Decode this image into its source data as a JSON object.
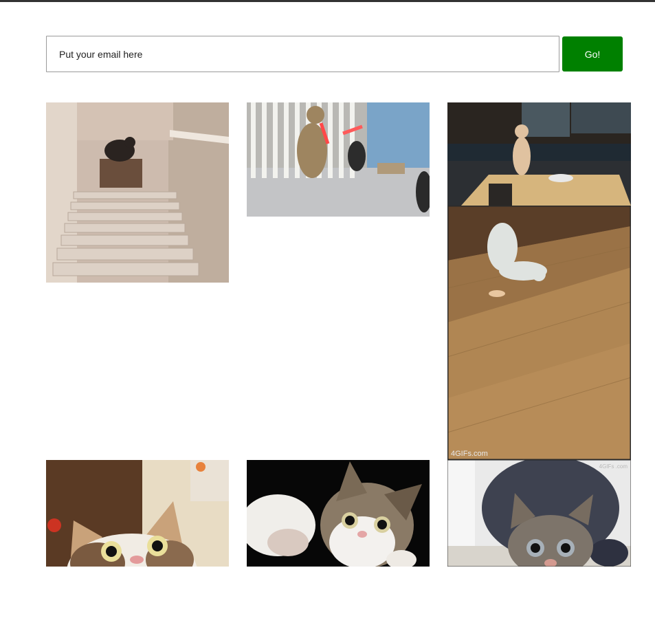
{
  "signup": {
    "email_placeholder": "Put your email here",
    "email_value": "",
    "submit_label": "Go!",
    "submit_color": "#008000"
  },
  "gallery": {
    "items": [
      {
        "icon": "cat-stairs-gif"
      },
      {
        "icon": "cats-lightsaber-gif"
      },
      {
        "icon": "cat-on-table-gif"
      },
      {
        "icon": "cat-chasing-laser-gif",
        "watermark": "4GIFs.com"
      },
      {
        "icon": "kitten-surprised-gif"
      },
      {
        "icon": "kitten-pawing-gif"
      },
      {
        "icon": "tabby-cat-crouching-gif",
        "watermark": "4GIFs .com"
      }
    ]
  }
}
